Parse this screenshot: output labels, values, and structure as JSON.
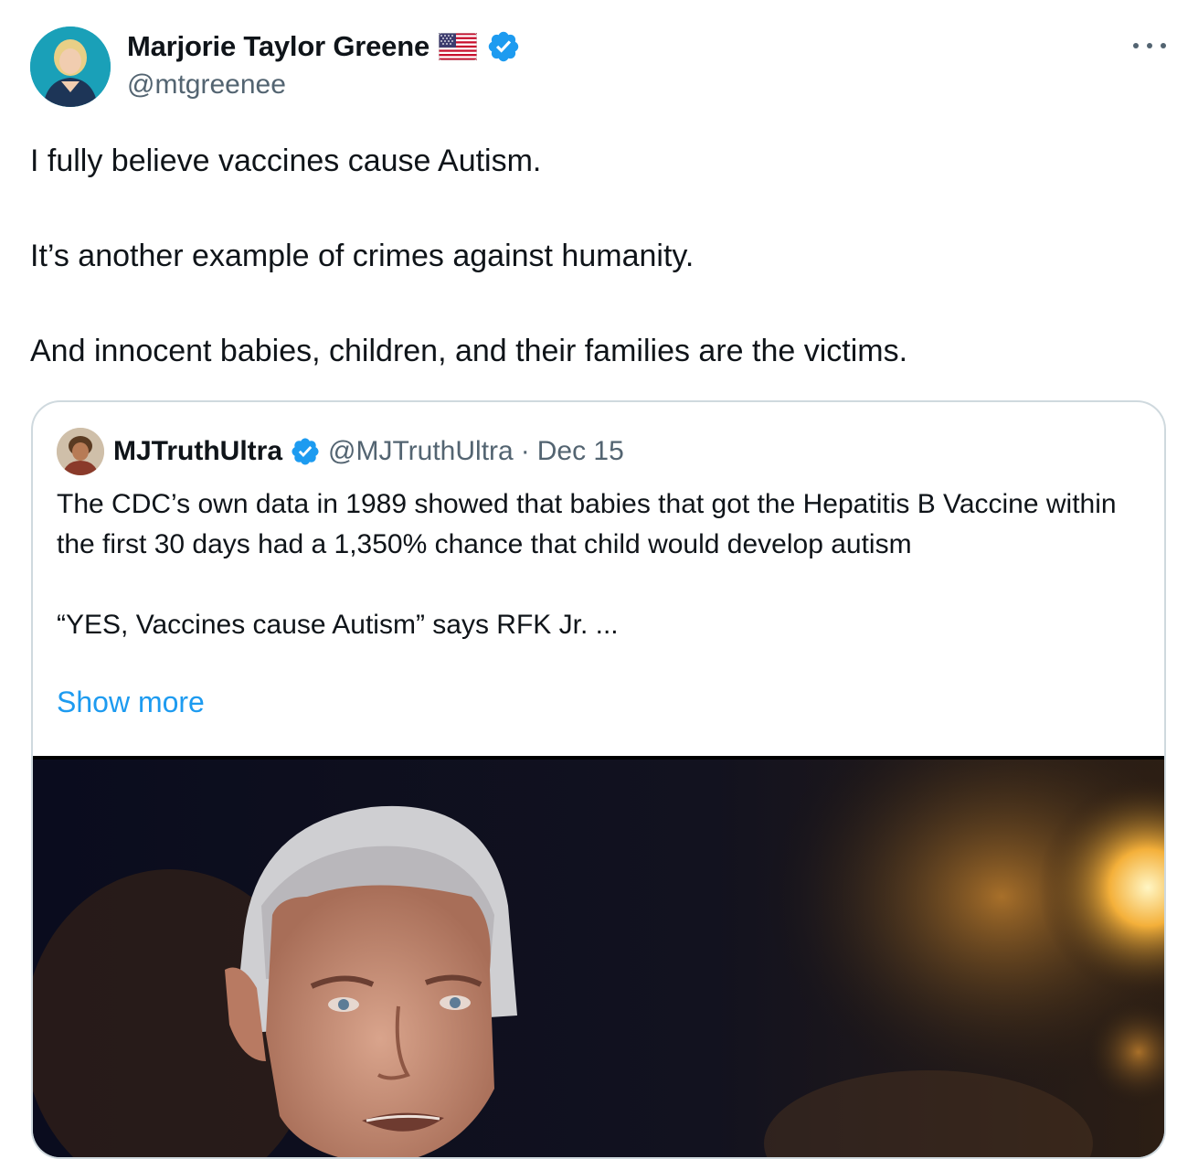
{
  "author": {
    "display_name": "Marjorie Taylor Greene",
    "handle": "@mtgreenee",
    "flag_icon": "us-flag-icon",
    "verified_icon": "verified-badge-icon"
  },
  "menu": {
    "more_icon": "more-horizontal-icon"
  },
  "tweet": {
    "paragraphs": [
      "I fully believe vaccines cause Autism.",
      "It’s another example of crimes against humanity.",
      "And innocent babies, children, and their families are the victims."
    ]
  },
  "quote": {
    "display_name": "MJTruthUltra",
    "handle": "@MJTruthUltra",
    "separator": "·",
    "date": "Dec 15",
    "paragraphs": [
      "The CDC’s own data in 1989 showed that babies that got the Hepatitis B Vaccine within the first 30 days had a 1,350% chance that child would develop autism",
      "“YES, Vaccines cause Autism” says RFK Jr. ..."
    ],
    "show_more_label": "Show more"
  },
  "colors": {
    "text": "#0f1419",
    "secondary": "#536471",
    "link": "#1d9bf0",
    "border": "#cfd9de",
    "verified": "#1d9bf0"
  }
}
